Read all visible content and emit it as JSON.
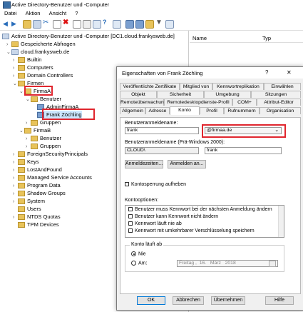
{
  "window": {
    "title": "Active Directory-Benutzer und -Computer"
  },
  "menu": [
    "Datei",
    "Aktion",
    "Ansicht",
    "?"
  ],
  "tree": {
    "root": "Active Directory-Benutzer und -Computer [DC1.cloud.frankysweb.de]",
    "saved_queries": "Gespeicherte Abfragen",
    "domain": "cloud.frankysweb.de",
    "items": {
      "builtin": "Builtin",
      "computers": "Computers",
      "dc": "Domain Controllers",
      "firmen": "Firmen",
      "firmaA": "FirmaA",
      "benutzerA": "Benutzer",
      "adminA": "AdminFirmaA",
      "frank": "Frank Zöchling",
      "gruppenA": "Gruppen",
      "firmaB": "FirmaB",
      "benutzerB": "Benutzer",
      "gruppenB": "Gruppen",
      "fsp": "ForeignSecurityPrincipals",
      "keys": "Keys",
      "lostfound": "LostAndFound",
      "msa": "Managed Service Accounts",
      "programdata": "Program Data",
      "shadow": "Shadow Groups",
      "system": "System",
      "users": "Users",
      "ntds": "NTDS Quotas",
      "tpm": "TPM Devices"
    }
  },
  "list": {
    "col_name": "Name",
    "col_type": "Typ"
  },
  "dialog": {
    "title": "Eigenschaften von Frank Zöchling",
    "help": "?",
    "close": "✕",
    "tabs_row1": [
      "Veröffentlichte Zertifikate",
      "Mitglied von",
      "Kennwortreplikation",
      "Einwählen"
    ],
    "tabs_row2": [
      "Objekt",
      "Sicherheit",
      "Umgebung",
      "Sitzungen"
    ],
    "tabs_row3": [
      "Remoteüberwachung",
      "Remotedesktopdienste-Profil",
      "COM+",
      "Attribut-Editor"
    ],
    "tabs_row4": [
      "Allgemein",
      "Adresse",
      "Konto",
      "Profil",
      "Rufnummern",
      "Organisation"
    ],
    "upn_label": "Benutzeranmeldename:",
    "upn_value": "frank",
    "upn_suffix": "@firmaa.de",
    "pre2000_label": "Benutzeranmeldename (Prä-Windows 2000):",
    "pre2000_domain": "CLOUD\\",
    "pre2000_value": "frank",
    "btn_logon_hours": "Anmeldezeiten...",
    "btn_logon_to": "Anmelden an...",
    "unlock": "Kontosperrung aufheben",
    "options_label": "Kontooptionen:",
    "options": [
      "Benutzer muss Kennwort bei der nächsten Anmeldung ändern",
      "Benutzer kann Kennwort nicht ändern",
      "Kennwort läuft nie ab",
      "Kennwort mit umkehrbarer Verschlüsselung speichern"
    ],
    "expires_label": "Konto läuft ab",
    "never": "Nie",
    "end_of": "Am:",
    "date": {
      "weekday": "Freitag",
      "day": "16.",
      "month": "März",
      "year": "2018"
    },
    "ok": "OK",
    "cancel": "Abbrechen",
    "apply": "Übernehmen",
    "helpbtn": "Hilfe"
  },
  "colors": {
    "highlight": "#e0262e",
    "selection": "#cce8ff",
    "folder": "#e8c35a"
  }
}
